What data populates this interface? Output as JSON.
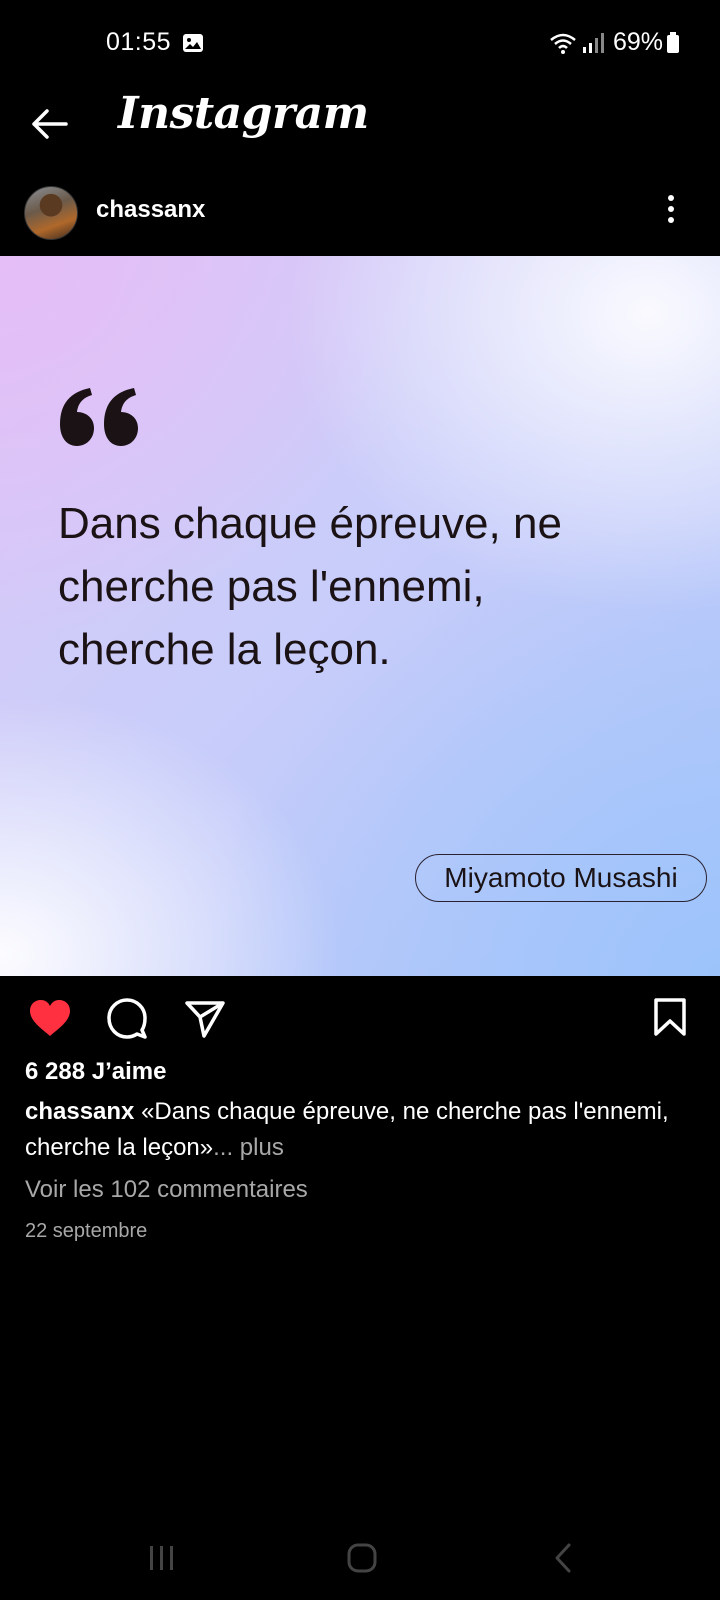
{
  "status_bar": {
    "time": "01:55",
    "battery": "69%",
    "icons": [
      "gallery-icon",
      "wifi-icon",
      "signal-icon",
      "battery-icon"
    ]
  },
  "header": {
    "app_name": "Instagram",
    "back_icon": "arrow-left-icon"
  },
  "post": {
    "username": "chassanx",
    "avatar_icon": "avatar",
    "more_icon": "more-vertical-icon",
    "image": {
      "quote_lines": [
        "Dans chaque épreuve, ne",
        "cherche pas l'ennemi,",
        "cherche la leçon."
      ],
      "author": "Miyamoto Musashi"
    },
    "actions": {
      "like_icon": "heart-filled-icon",
      "comment_icon": "comment-icon",
      "share_icon": "send-icon",
      "save_icon": "bookmark-icon",
      "liked": true
    },
    "likes": "6 288 J’aime",
    "caption": {
      "user": "chassanx",
      "text": " «Dans chaque épreuve, ne cherche pas l'ennemi, cherche la leçon»",
      "more": "... plus"
    },
    "comments_link": "Voir les 102 commentaires",
    "date": "22 septembre"
  },
  "nav": {
    "recents_icon": "recent-apps-icon",
    "home_icon": "home-icon",
    "back_icon": "nav-back-icon"
  },
  "colors": {
    "background": "#000000",
    "like_red": "#ff3040",
    "secondary_text": "#a8a8a8"
  }
}
